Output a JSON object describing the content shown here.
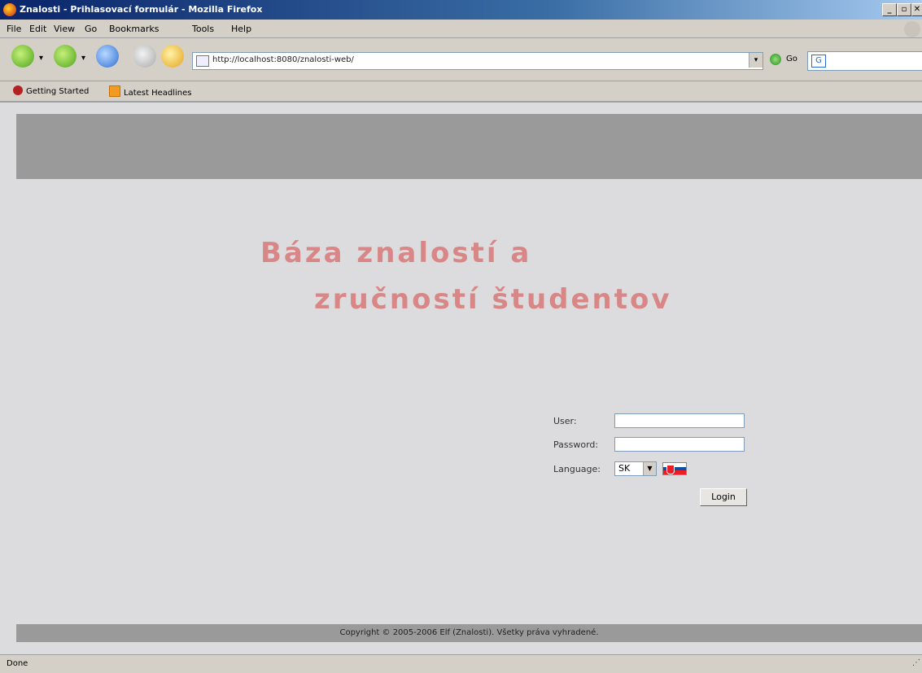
{
  "window": {
    "title": "Znalosti - Prihlasovací formulár - Mozilla Firefox",
    "min_label": "_",
    "max_label": "▫",
    "close_label": "✕"
  },
  "menu": [
    "File",
    "Edit",
    "View",
    "Go",
    "Bookmarks",
    "Tools",
    "Help"
  ],
  "toolbar": {
    "url": "http://localhost:8080/znalosti-web/",
    "go_label": "Go"
  },
  "bookmarks": {
    "items": [
      "Getting Started",
      "Latest Headlines"
    ]
  },
  "page": {
    "heading_line1": "Báza znalostí a",
    "heading_line2": "zručností študentov",
    "heading_color": "#d88686",
    "band_color": "#9a9a9a",
    "footer": "Copyright © 2005-2006 Elf (Znalosti). Všetky práva vyhradené."
  },
  "login": {
    "user_label": "User:",
    "password_label": "Password:",
    "language_label": "Language:",
    "language_value": "SK",
    "button_label": "Login",
    "flag_icon": "slovakia-flag-icon"
  },
  "status": {
    "text": "Done"
  }
}
